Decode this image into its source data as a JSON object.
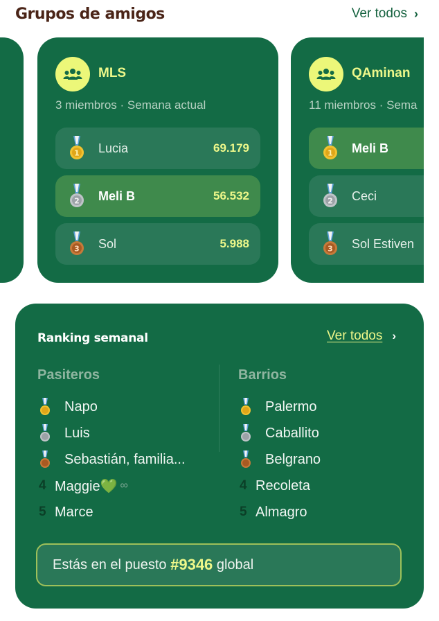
{
  "header": {
    "title": "Grupos de amigos",
    "see_all_label": "Ver todos",
    "chevron": "›"
  },
  "groups": [
    {
      "name": "MLS",
      "meta": "3 miembros · Semana actual",
      "members": [
        {
          "name": "Lucia",
          "score": "69.179",
          "medal": "gold",
          "highlight": false
        },
        {
          "name": "Meli B",
          "score": "56.532",
          "medal": "silver",
          "highlight": true
        },
        {
          "name": "Sol",
          "score": "5.988",
          "medal": "bronze",
          "highlight": false
        }
      ]
    },
    {
      "name": "QAminan",
      "meta": "11 miembros · Sema",
      "members": [
        {
          "name": "Meli B",
          "medal": "gold",
          "highlight": true
        },
        {
          "name": "Ceci",
          "medal": "silver",
          "highlight": false
        },
        {
          "name": "Sol Estiven",
          "medal": "bronze",
          "highlight": false
        }
      ]
    }
  ],
  "ranking": {
    "title": "Ranking semanal",
    "see_all_label": "Ver todos",
    "chevron": "›",
    "left_column": {
      "heading": "Pasiteros",
      "items": [
        {
          "rank": "1",
          "name": "Napo",
          "medal": "gold"
        },
        {
          "rank": "2",
          "name": "Luis",
          "medal": "silver"
        },
        {
          "rank": "3",
          "name": "Sebastián,  familia...",
          "medal": "bronze"
        },
        {
          "rank": "4",
          "name": "Maggie💚",
          "extra": "∞"
        },
        {
          "rank": "5",
          "name": "Marce"
        }
      ]
    },
    "right_column": {
      "heading": "Barrios",
      "items": [
        {
          "rank": "1",
          "name": "Palermo",
          "medal": "gold"
        },
        {
          "rank": "2",
          "name": "Caballito",
          "medal": "silver"
        },
        {
          "rank": "3",
          "name": "Belgrano",
          "medal": "bronze"
        },
        {
          "rank": "4",
          "name": "Recoleta"
        },
        {
          "rank": "5",
          "name": "Almagro"
        }
      ]
    },
    "position": {
      "prefix": "Estás en el puesto ",
      "value": "#9346",
      "suffix": " global"
    }
  },
  "colors": {
    "card_green": "#136b45",
    "accent_yellow": "#eef88a",
    "title_brown": "#4a2417",
    "medal_gold": "#f2c230",
    "medal_silver": "#a9aeb2",
    "medal_bronze": "#b8692e"
  },
  "icons": {
    "group": "group-icon",
    "chevron": "chevron-right-icon",
    "medal_gold": "gold-medal-icon",
    "medal_silver": "silver-medal-icon",
    "medal_bronze": "bronze-medal-icon"
  }
}
